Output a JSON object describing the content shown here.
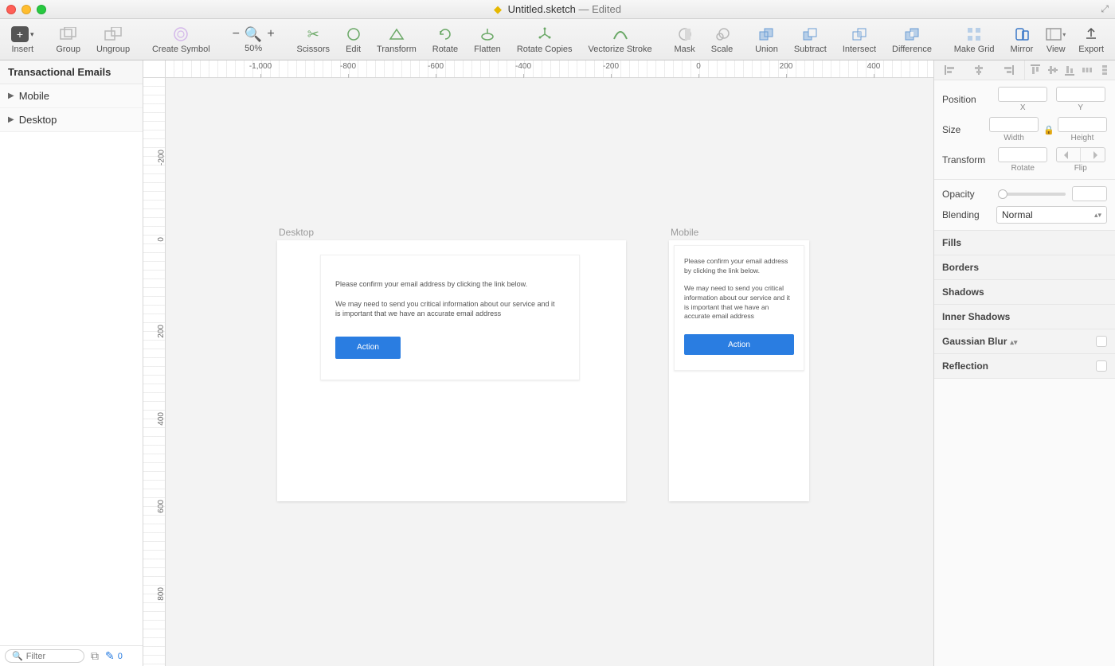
{
  "titlebar": {
    "filename": "Untitled.sketch",
    "suffix": " — Edited"
  },
  "toolbar": {
    "insert": "Insert",
    "group": "Group",
    "ungroup": "Ungroup",
    "create_symbol": "Create Symbol",
    "zoom": "50%",
    "scissors": "Scissors",
    "edit": "Edit",
    "transform": "Transform",
    "rotate": "Rotate",
    "flatten": "Flatten",
    "rotate_copies": "Rotate Copies",
    "vectorize": "Vectorize Stroke",
    "mask": "Mask",
    "scale": "Scale",
    "union": "Union",
    "subtract": "Subtract",
    "intersect": "Intersect",
    "difference": "Difference",
    "make_grid": "Make Grid",
    "mirror": "Mirror",
    "view": "View",
    "export": "Export"
  },
  "sidebar": {
    "title": "Transactional Emails",
    "items": [
      "Mobile",
      "Desktop"
    ],
    "filter_placeholder": "Filter",
    "count": "0"
  },
  "ruler_h": [
    "-1,000",
    "-800",
    "-600",
    "-400",
    "-200",
    "0",
    "200",
    "400"
  ],
  "ruler_v": [
    "-200",
    "0",
    "200",
    "400",
    "600",
    "800"
  ],
  "artboards": {
    "desktop": {
      "label": "Desktop",
      "line1": "Please confirm your email address by clicking the link below.",
      "line2": "We may need to send you critical information about our service and it is important that we have an accurate email address",
      "action": "Action"
    },
    "mobile": {
      "label": "Mobile",
      "line1": "Please confirm your email address by clicking the link below.",
      "line2": "We may need to send you critical information about our service and it is important that we have an accurate email address",
      "action": "Action"
    }
  },
  "inspector": {
    "position": "Position",
    "x": "X",
    "y": "Y",
    "size": "Size",
    "width": "Width",
    "height": "Height",
    "transform": "Transform",
    "rotate": "Rotate",
    "flip": "Flip",
    "opacity": "Opacity",
    "blending": "Blending",
    "blend_val": "Normal",
    "fills": "Fills",
    "borders": "Borders",
    "shadows": "Shadows",
    "inner_shadows": "Inner Shadows",
    "gaussian_blur": "Gaussian Blur",
    "reflection": "Reflection"
  }
}
